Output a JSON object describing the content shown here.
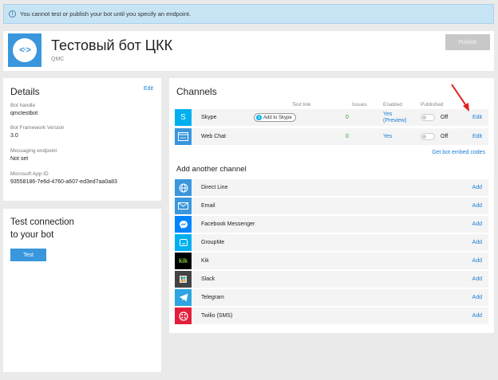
{
  "banner": {
    "text": "You cannot test or publish your bot until you specify an endpoint."
  },
  "header": {
    "title": "Тестовый бот ЦКК",
    "subtitle": "QMC",
    "publish_label": "Publish"
  },
  "details": {
    "title": "Details",
    "edit_label": "Edit",
    "fields": [
      {
        "label": "Bot handle",
        "value": "qmctestbot"
      },
      {
        "label": "Bot Framework Version",
        "value": "3.0"
      },
      {
        "label": "Messaging endpoint",
        "value": "Not set"
      },
      {
        "label": "Microsoft App ID",
        "value": "93558186-7e6d-4760-a607-ed3ed7aa0a83"
      }
    ]
  },
  "test_panel": {
    "title_line1": "Test connection",
    "title_line2": "to your bot",
    "test_label": "Test"
  },
  "channels": {
    "title": "Channels",
    "columns": {
      "test_link": "Test link",
      "issues": "Issues",
      "enabled": "Enabled",
      "published": "Published"
    },
    "rows": [
      {
        "name": "Skype",
        "add_to_skype": "Add to Skype",
        "issues": "0",
        "enabled_line1": "Yes",
        "enabled_line2": "(Preview)",
        "published": "Off",
        "edit": "Edit",
        "icon": "skype-icon",
        "color": "#00aff0"
      },
      {
        "name": "Web Chat",
        "issues": "0",
        "enabled_line1": "Yes",
        "published": "Off",
        "edit": "Edit",
        "icon": "webchat-icon",
        "color": "#3a96dd"
      }
    ],
    "embed_link": "Get bot embed codes",
    "add_title": "Add another channel",
    "add_label": "Add",
    "available": [
      {
        "name": "Direct Line",
        "icon": "globe-icon",
        "color": "#3a96dd"
      },
      {
        "name": "Email",
        "icon": "email-icon",
        "color": "#3a96dd"
      },
      {
        "name": "Facebook Messenger",
        "icon": "messenger-icon",
        "color": "#0084ff"
      },
      {
        "name": "GroupMe",
        "icon": "groupme-icon",
        "color": "#00aff0"
      },
      {
        "name": "Kik",
        "icon": "kik-icon",
        "color": "#000000"
      },
      {
        "name": "Slack",
        "icon": "slack-icon",
        "color": "#444444"
      },
      {
        "name": "Telegram",
        "icon": "telegram-icon",
        "color": "#2ca5e0"
      },
      {
        "name": "Twilio (SMS)",
        "icon": "twilio-icon",
        "color": "#e31e3a"
      }
    ]
  }
}
